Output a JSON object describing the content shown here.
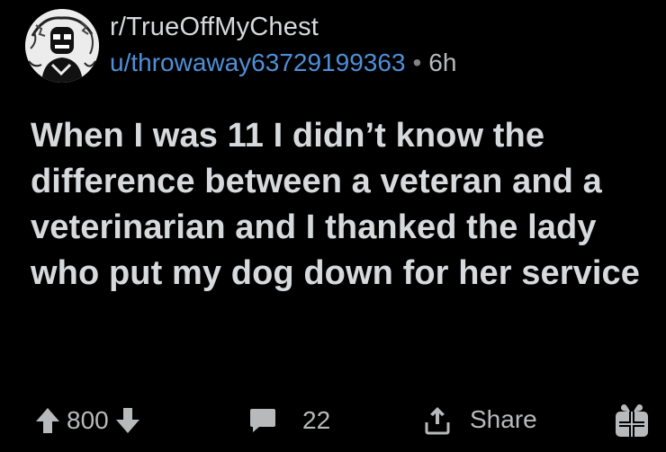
{
  "post": {
    "subreddit": "r/TrueOffMyChest",
    "username": "u/throwaway63729199363",
    "separator": "•",
    "age": "6h",
    "title": "When I was 11 I didn’t know the difference between a veteran and a veterinarian and I thanked the lady who put my dog down for her service"
  },
  "actions": {
    "votes": "800",
    "comments": "22",
    "share_label": "Share"
  },
  "colors": {
    "background": "#000000",
    "text": "#d7dadc",
    "username": "#4f8fd8",
    "muted": "#b7b9bb"
  },
  "icons": {
    "avatar": "subreddit-avatar-icon",
    "upvote": "upvote-arrow-icon",
    "downvote": "downvote-arrow-icon",
    "comment": "comment-bubble-icon",
    "share": "share-icon",
    "award": "award-gift-icon"
  }
}
